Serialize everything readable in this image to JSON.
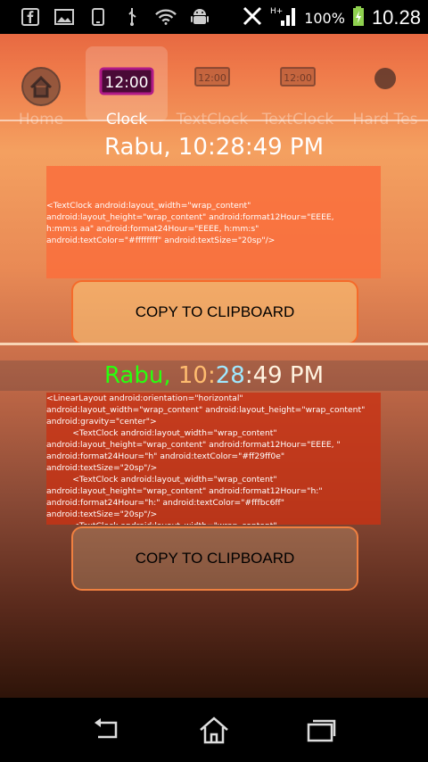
{
  "status_bar": {
    "left_icons": [
      "facebook-icon",
      "image-icon",
      "phone-icon",
      "usb-icon",
      "wifi-icon",
      "android-icon"
    ],
    "right_icons": [
      "no-sim-icon",
      "signal-icon",
      "battery-charging-icon"
    ],
    "battery": "100%",
    "time": "10.28"
  },
  "tabs": [
    {
      "label": "Home",
      "icon": "home-icon",
      "active": false
    },
    {
      "label": "Clock",
      "icon": "digital-clock-icon",
      "active": true
    },
    {
      "label": "TextClock",
      "icon": "digital-clock-icon",
      "active": false
    },
    {
      "label": "TextClock",
      "icon": "digital-clock-icon",
      "active": false
    },
    {
      "label": "Hard Tes",
      "icon": "dot-icon",
      "active": false
    }
  ],
  "clock1": {
    "text": "Rabu, 10:28:49 PM"
  },
  "code1": "<TextClock android:layout_width=\"wrap_content\"\nandroid:layout_height=\"wrap_content\" android:format12Hour=\"EEEE,\nh:mm:s aa\" android:format24Hour=\"EEEE, h:mm:s\"\nandroid:textColor=\"#ffffffff\" android:textSize=\"20sp\"/>",
  "button1": "COPY TO CLIPBOARD",
  "clock2": {
    "part1": "Rabu, ",
    "part2": "10:",
    "part3": "28",
    "part4": ":49 PM",
    "colors": [
      "#29ff0e",
      "#ffbc6f",
      "#9fe8ff",
      "#fff3e0"
    ]
  },
  "code2": "<LinearLayout android:orientation=\"horizontal\"\nandroid:layout_width=\"wrap_content\" android:layout_height=\"wrap_content\"\nandroid:gravity=\"center\">\n          <TextClock android:layout_width=\"wrap_content\"\nandroid:layout_height=\"wrap_content\" android:format12Hour=\"EEEE, \"\nandroid:format24Hour=\"h\" android:textColor=\"#ff29ff0e\"\nandroid:textSize=\"20sp\"/>\n          <TextClock android:layout_width=\"wrap_content\"\nandroid:layout_height=\"wrap_content\" android:format12Hour=\"h:\"\nandroid:format24Hour=\"h:\" android:textColor=\"#fffbc6ff\"\nandroid:textSize=\"20sp\"/>\n          <TextClock android:layout_width=\"wrap_content\"",
  "button2": "COPY TO CLIPBOARD",
  "nav": [
    "back-icon",
    "home-icon",
    "recents-icon"
  ]
}
